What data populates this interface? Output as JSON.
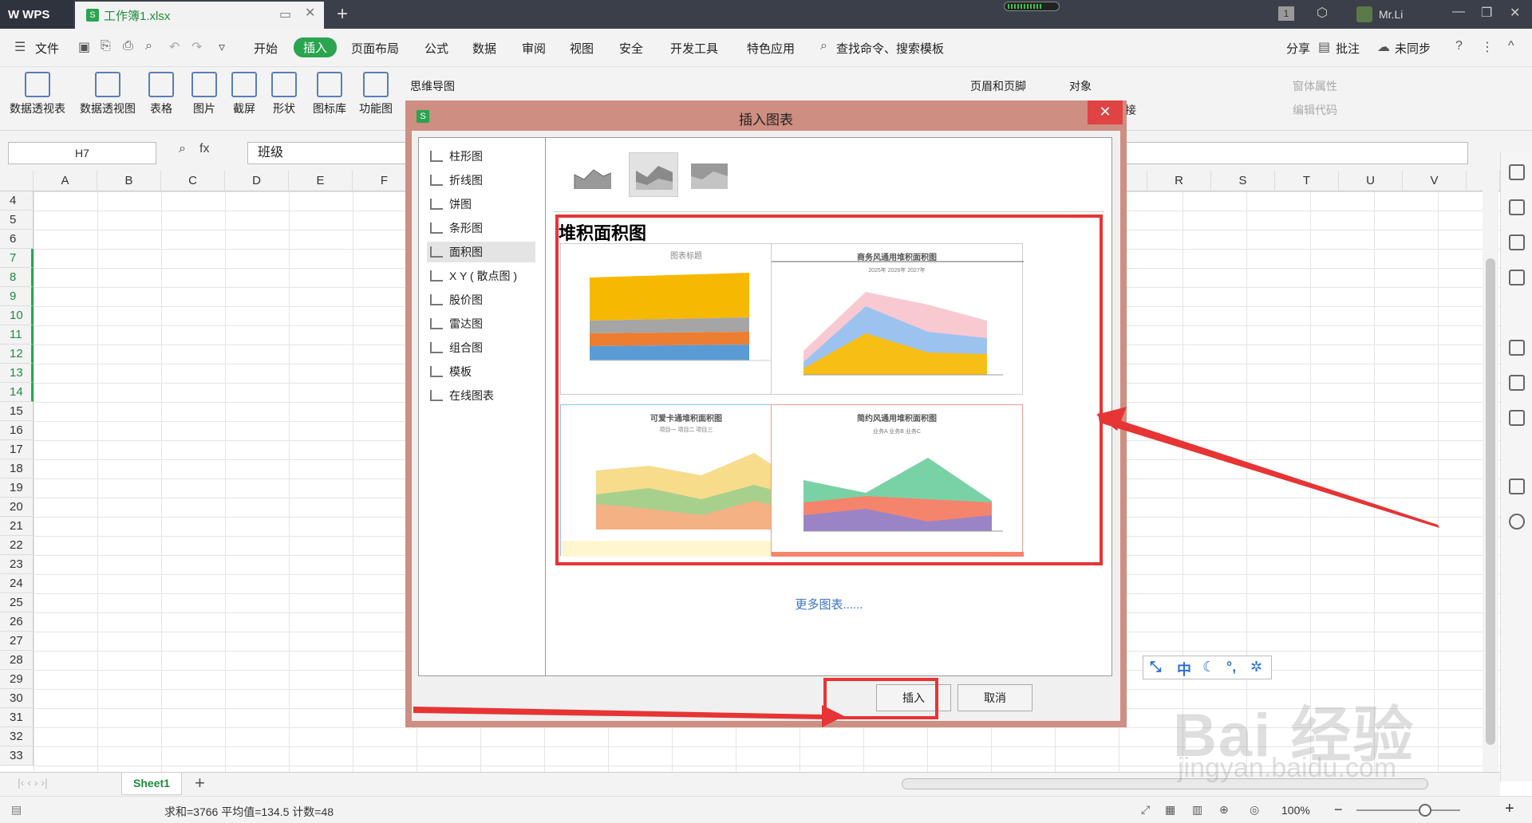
{
  "titlebar": {
    "app_name": "WPS",
    "file_tab": "工作簿1.xlsx",
    "user": "Mr.Li",
    "page_badge": "1"
  },
  "menubar": {
    "file": "文件",
    "items": [
      "开始",
      "插入",
      "页面布局",
      "公式",
      "数据",
      "审阅",
      "视图",
      "安全",
      "开发工具",
      "特色应用"
    ],
    "active": "插入",
    "search": "查找命令、搜索模板",
    "share": "分享",
    "comment": "批注",
    "sync": "未同步"
  },
  "toolbar": {
    "tools": [
      "数据透视表",
      "数据透视图",
      "表格",
      "图片",
      "截屏",
      "形状",
      "图标库",
      "功能图",
      "思维导图",
      "页眉和页脚",
      "对象",
      "链接",
      "窗体属性",
      "编辑代码"
    ]
  },
  "formula": {
    "cell_ref": "H7",
    "fx": "fx",
    "value": "班级"
  },
  "sheet": {
    "columns_left": [
      "A",
      "B",
      "C",
      "D",
      "E",
      "F"
    ],
    "columns_right": [
      "R",
      "S",
      "T",
      "U",
      "V"
    ],
    "rows": [
      "4",
      "5",
      "6",
      "7",
      "8",
      "9",
      "10",
      "11",
      "12",
      "13",
      "14",
      "15",
      "16",
      "17",
      "18",
      "19",
      "20",
      "21",
      "22",
      "23",
      "24",
      "25",
      "26",
      "27",
      "28",
      "29",
      "30",
      "31",
      "32",
      "33"
    ],
    "selected_rows": [
      "7",
      "8",
      "9",
      "10",
      "11",
      "12",
      "13",
      "14"
    ],
    "tab": "Sheet1",
    "add_tab": "+"
  },
  "status": {
    "text": "求和=3766  平均值=134.5  计数=48",
    "zoom": "100%"
  },
  "dialog": {
    "title": "插入图表",
    "close": "✕",
    "categories": [
      "柱形图",
      "折线图",
      "饼图",
      "条形图",
      "面积图",
      "X Y ( 散点图 )",
      "股价图",
      "雷达图",
      "组合图",
      "模板",
      "在线图表"
    ],
    "selected_category": "面积图",
    "section_title": "堆积面积图",
    "templates": [
      {
        "caption": "图表标题"
      },
      {
        "caption": "商务风通用堆积面积图",
        "legend": "2025年  2026年  2027年"
      },
      {
        "caption": "可爱卡通堆积面积图",
        "legend": "项目一  项目二  项目三"
      },
      {
        "caption": "简约风通用堆积面积图",
        "legend": "业务A  业务B  业务C"
      }
    ],
    "more": "更多图表......",
    "insert": "插入",
    "cancel": "取消"
  },
  "ime": {
    "mode": "中"
  },
  "watermark": {
    "main": "Bai 经验",
    "sub": "jingyan.baidu.com"
  },
  "colors": {
    "accent": "#2aa44f",
    "highlight": "#e73434",
    "dialog_frame": "#ce8e82"
  }
}
